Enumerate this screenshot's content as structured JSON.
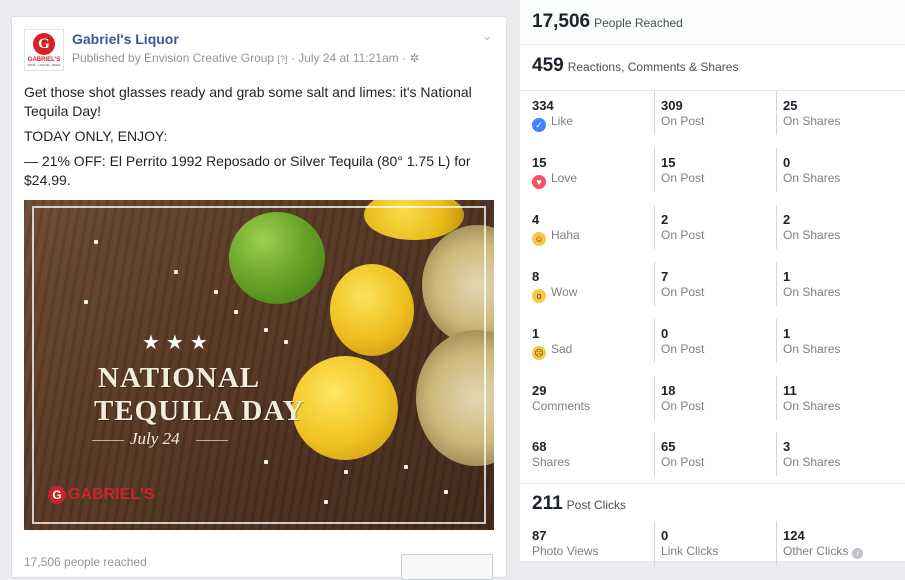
{
  "post": {
    "page_name": "Gabriel's Liquor",
    "byline_prefix": "Published by Envision Creative Group",
    "byline_q": "[?]",
    "byline_sep": " · ",
    "byline_date": "July 24 at 11:21am",
    "byline_globe": "·",
    "logo": {
      "letter": "G",
      "text": "GABRIEL'S",
      "sub": "WINE · LIQUOR · BEER"
    },
    "body": [
      "Get those shot glasses ready and grab some salt and limes: it's National Tequila Day!",
      "TODAY ONLY, ENJOY:",
      "— 21% OFF: El Perrito 1992 Reposado or Silver Tequila (80° 1.75 L) for $24.99."
    ],
    "image": {
      "stars": "★★★",
      "line1": "NATIONAL",
      "line2": "TEQUILA DAY",
      "date": "July 24",
      "brand": "GABRIEL'S",
      "brand_letter": "G"
    },
    "footer": "17,506 people reached"
  },
  "stats": {
    "reached": {
      "value": "17,506",
      "label": "People Reached"
    },
    "reactions": {
      "value": "459",
      "label": "Reactions, Comments & Shares"
    },
    "rows": [
      {
        "icon": "like-icon",
        "glyph": "👍",
        "total": "334",
        "name": "Like",
        "post": "309",
        "post_label": "On Post",
        "shares": "25",
        "shares_label": "On Shares"
      },
      {
        "icon": "love-icon",
        "glyph": "♥",
        "total": "15",
        "name": "Love",
        "post": "15",
        "post_label": "On Post",
        "shares": "0",
        "shares_label": "On Shares"
      },
      {
        "icon": "haha-icon",
        "glyph": "😆",
        "total": "4",
        "name": "Haha",
        "post": "2",
        "post_label": "On Post",
        "shares": "2",
        "shares_label": "On Shares"
      },
      {
        "icon": "wow-icon",
        "glyph": "😮",
        "total": "8",
        "name": "Wow",
        "post": "7",
        "post_label": "On Post",
        "shares": "1",
        "shares_label": "On Shares"
      },
      {
        "icon": "sad-icon",
        "glyph": "😢",
        "total": "1",
        "name": "Sad",
        "post": "0",
        "post_label": "On Post",
        "shares": "1",
        "shares_label": "On Shares"
      },
      {
        "icon": "",
        "glyph": "",
        "total": "29",
        "name": "Comments",
        "post": "18",
        "post_label": "On Post",
        "shares": "11",
        "shares_label": "On Shares"
      },
      {
        "icon": "",
        "glyph": "",
        "total": "68",
        "name": "Shares",
        "post": "65",
        "post_label": "On Post",
        "shares": "3",
        "shares_label": "On Shares"
      }
    ],
    "clicks": {
      "value": "211",
      "label": "Post Clicks",
      "photo_views": "87",
      "photo_views_label": "Photo Views",
      "link_clicks": "0",
      "link_clicks_label": "Link Clicks",
      "other_clicks": "124",
      "other_clicks_label": "Other Clicks"
    }
  },
  "colors": {
    "link": "#365899",
    "like": "#4080ff",
    "love": "#f25268",
    "brand_red": "#d42027"
  }
}
